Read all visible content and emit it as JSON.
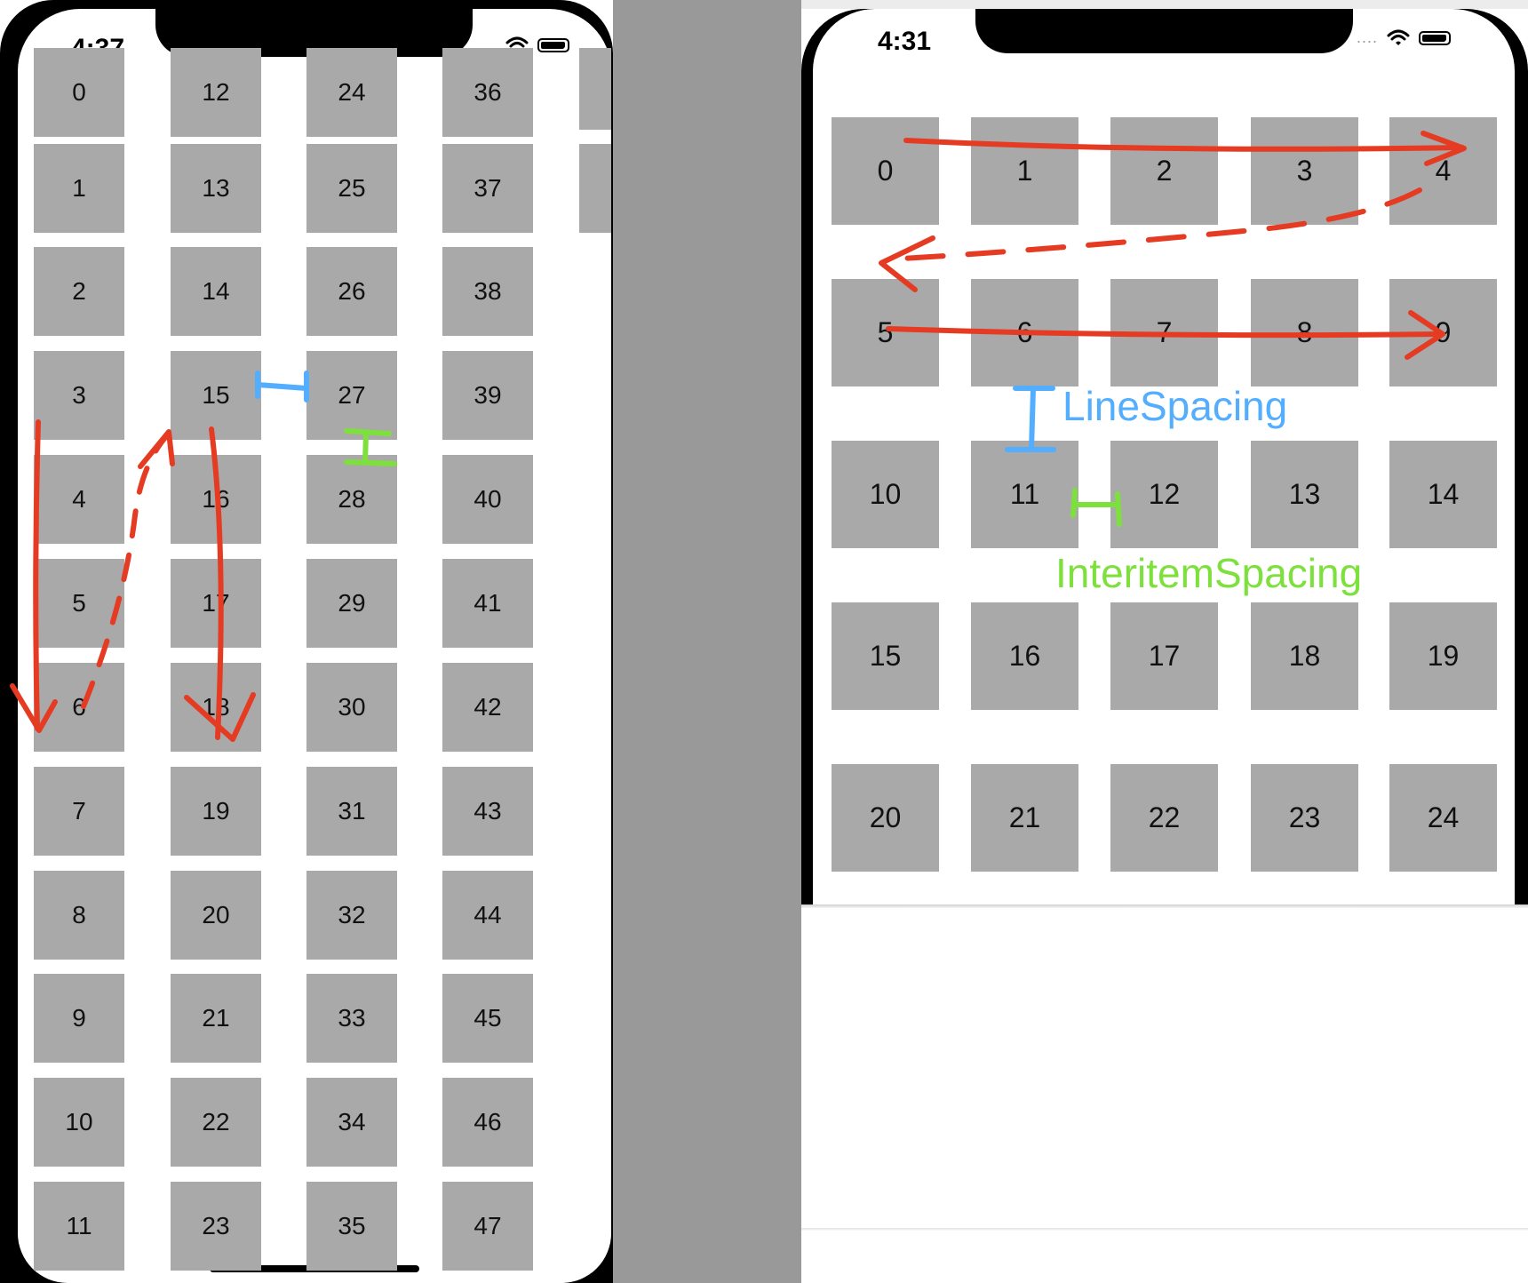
{
  "left_phone": {
    "time": "4:37",
    "cells": [
      "0",
      "1",
      "2",
      "3",
      "4",
      "5",
      "6",
      "7",
      "8",
      "9",
      "10",
      "11",
      "12",
      "13",
      "14",
      "15",
      "16",
      "17",
      "18",
      "19",
      "20",
      "21",
      "22",
      "23",
      "24",
      "25",
      "26",
      "27",
      "28",
      "29",
      "30",
      "31",
      "32",
      "33",
      "34",
      "35",
      "36",
      "37",
      "38",
      "39",
      "40",
      "41",
      "42",
      "43",
      "44",
      "45",
      "46",
      "47"
    ]
  },
  "right_phone": {
    "time": "4:31",
    "cells": [
      "0",
      "1",
      "2",
      "3",
      "4",
      "5",
      "6",
      "7",
      "8",
      "9",
      "10",
      "11",
      "12",
      "13",
      "14",
      "15",
      "16",
      "17",
      "18",
      "19",
      "20",
      "21",
      "22",
      "23",
      "24"
    ],
    "annotations": {
      "line_spacing": "LineSpacing",
      "interitem_spacing": "InteritemSpacing"
    }
  },
  "colors": {
    "cell": "#a9a9a9",
    "arrow_red": "#e53b23",
    "line_spacing_blue": "#53aeff",
    "interitem_green": "#7ee03c"
  }
}
